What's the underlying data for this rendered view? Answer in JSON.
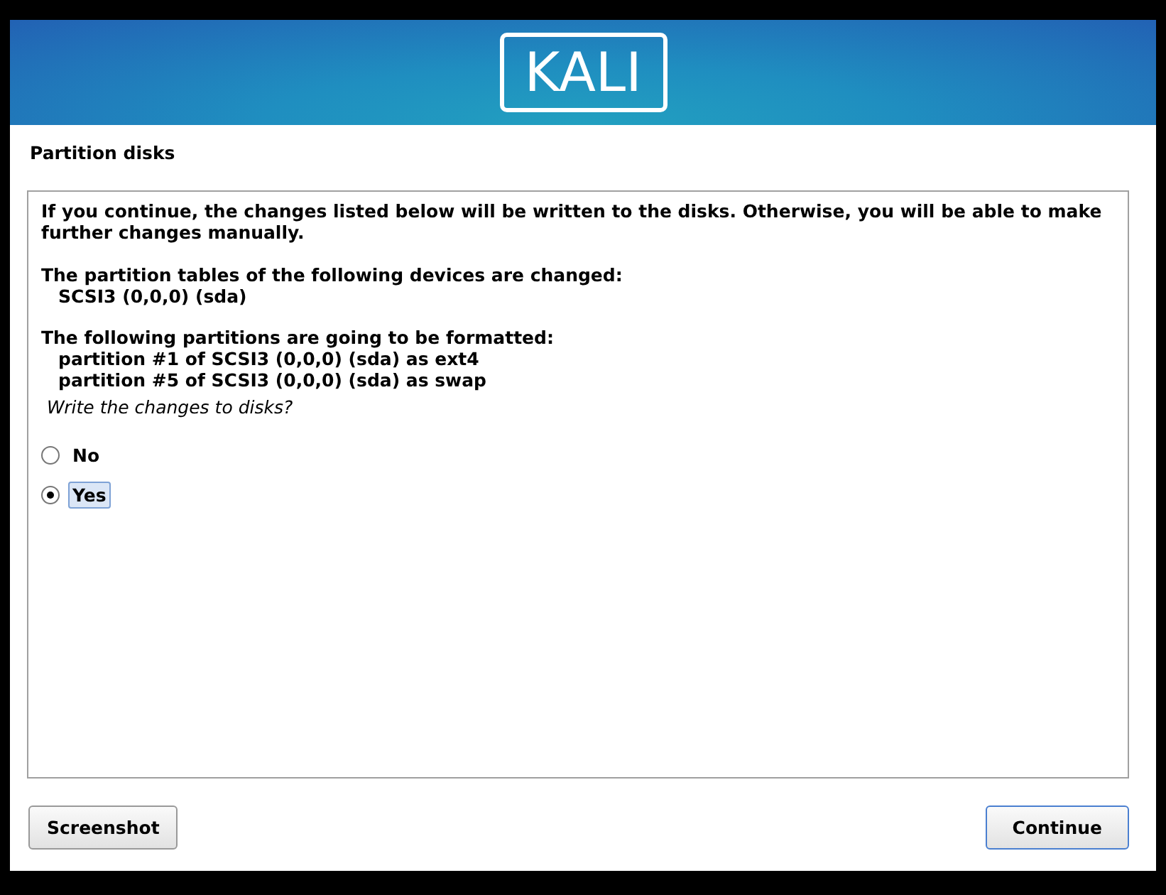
{
  "banner": {
    "logo": "KALI"
  },
  "title": "Partition disks",
  "body": {
    "intro": "If you continue, the changes listed below will be written to the disks. Otherwise, you will be able to make further changes manually.",
    "sections": [
      {
        "heading": "The partition tables of the following devices are changed:",
        "items": [
          "SCSI3 (0,0,0) (sda)"
        ]
      },
      {
        "heading": "The following partitions are going to be formatted:",
        "items": [
          "partition #1 of SCSI3 (0,0,0) (sda) as ext4",
          "partition #5 of SCSI3 (0,0,0) (sda) as swap"
        ]
      }
    ],
    "question": "Write the changes to disks?",
    "options": [
      {
        "label": "No",
        "selected": false
      },
      {
        "label": "Yes",
        "selected": true
      }
    ]
  },
  "buttons": [
    {
      "label": "Screenshot",
      "focused": false
    },
    {
      "label": "Continue",
      "focused": true
    }
  ]
}
